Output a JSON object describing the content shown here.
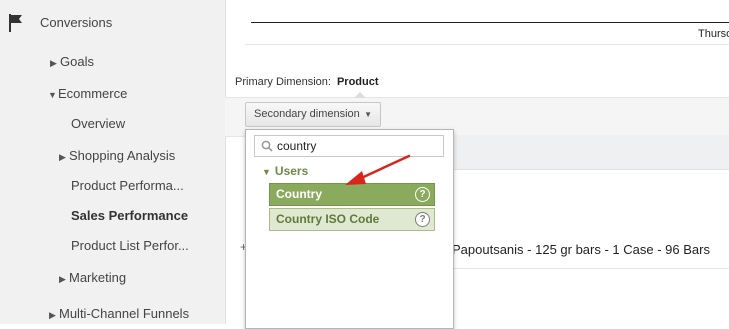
{
  "sidebar": {
    "section_title": "Conversions",
    "items": [
      {
        "label": "Goals"
      },
      {
        "label": "Ecommerce"
      },
      {
        "label": "Overview"
      },
      {
        "label": "Shopping Analysis"
      },
      {
        "label": "Product Performa..."
      },
      {
        "label": "Sales Performance"
      },
      {
        "label": "Product List Perfor..."
      },
      {
        "label": "Marketing"
      },
      {
        "label": "Multi-Channel Funnels"
      }
    ]
  },
  "chart": {
    "axis_label": "Thurso"
  },
  "main": {
    "primary_dimension_label": "Primary Dimension:",
    "primary_dimension_value": "Product",
    "secondary_dimension_button": "Secondary dimension",
    "row_product": "Papoutsanis - 125 gr bars - 1 Case - 96 Bars"
  },
  "dropdown": {
    "search_value": "country",
    "group_label": "Users",
    "options": [
      {
        "label": "Country",
        "selected": true
      },
      {
        "label": "Country ISO Code",
        "selected": false
      }
    ],
    "help_glyph": "?"
  },
  "colors": {
    "selected_option": "#8aab5e",
    "unselected_option": "#dfe8d0",
    "group_label": "#6d8a47",
    "annotation_arrow": "#d9261c"
  }
}
